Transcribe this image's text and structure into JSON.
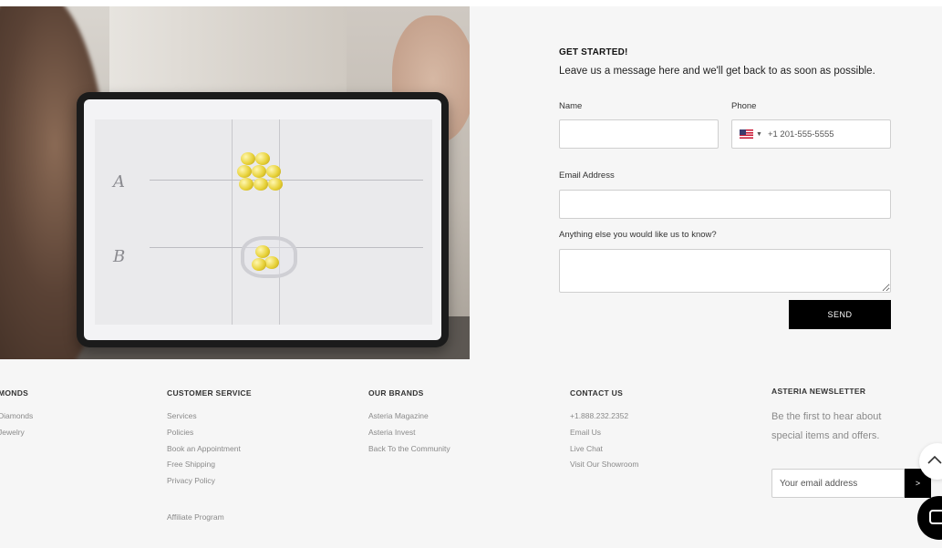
{
  "form": {
    "title": "GET STARTED!",
    "subtitle": "Leave us a message here and we'll get back to as soon as possible.",
    "name_label": "Name",
    "phone_label": "Phone",
    "phone_placeholder": "+1 201-555-5555",
    "phone_country_icon": "us-flag-icon",
    "email_label": "Email Address",
    "message_label": "Anything else you would like us to know?",
    "send_label": "SEND"
  },
  "photo": {
    "letters": [
      "A",
      "B"
    ]
  },
  "footer": {
    "diamonds": {
      "heading": "MONDS",
      "items": [
        "Diamonds",
        "Jewelry"
      ]
    },
    "customer_service": {
      "heading": "CUSTOMER SERVICE",
      "items": [
        "Services",
        "Policies",
        "Book an Appointment",
        "Free Shipping",
        "Privacy Policy",
        "Affiliate Program"
      ]
    },
    "brands": {
      "heading": "OUR BRANDS",
      "items": [
        "Asteria Magazine",
        "Asteria Invest",
        "Back To the Community"
      ]
    },
    "contact": {
      "heading": "CONTACT US",
      "items": [
        "+1.888.232.2352",
        "Email Us",
        "Live Chat",
        "Visit Our Showroom"
      ]
    },
    "newsletter": {
      "heading": "ASTERIA NEWSLETTER",
      "text": "Be the first to hear about special items and offers.",
      "placeholder": "Your email address",
      "submit_label": ">"
    }
  },
  "icons": {
    "scroll_top": "chevron-up-icon",
    "chat": "chat-icon"
  },
  "colors": {
    "background": "#f6f6f6",
    "button": "#000000",
    "muted_text": "#8a8a8a"
  }
}
